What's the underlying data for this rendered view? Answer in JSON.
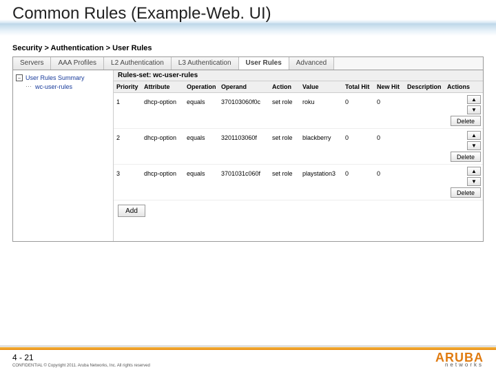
{
  "slide_title": "Common Rules (Example-Web. UI)",
  "breadcrumb": "Security > Authentication > User Rules",
  "tabs": [
    "Servers",
    "AAA Profiles",
    "L2 Authentication",
    "L3 Authentication",
    "User Rules",
    "Advanced"
  ],
  "active_tab": "User Rules",
  "tree": {
    "root": "User Rules Summary",
    "child": "wc-user-rules"
  },
  "grid": {
    "title": "Rules-set: wc-user-rules",
    "headers": [
      "Priority",
      "Attribute",
      "Operation",
      "Operand",
      "Action",
      "Value",
      "Total Hit",
      "New Hit",
      "Description",
      "Actions"
    ],
    "rows": [
      {
        "priority": "1",
        "attribute": "dhcp-option",
        "operation": "equals",
        "operand": "370103060f0c",
        "action": "set role",
        "value": "roku",
        "total_hit": "0",
        "new_hit": "0",
        "description": ""
      },
      {
        "priority": "2",
        "attribute": "dhcp-option",
        "operation": "equals",
        "operand": "3201103060f",
        "action": "set role",
        "value": "blackberry",
        "total_hit": "0",
        "new_hit": "0",
        "description": ""
      },
      {
        "priority": "3",
        "attribute": "dhcp-option",
        "operation": "equals",
        "operand": "3701031c060f",
        "action": "set role",
        "value": "playstation3",
        "total_hit": "0",
        "new_hit": "0",
        "description": ""
      }
    ],
    "buttons": {
      "up": "▲",
      "down": "▼",
      "delete": "Delete",
      "add": "Add"
    }
  },
  "footer": {
    "page": "4 - 21",
    "confidential": "CONFIDENTIAL © Copyright 2011. Aruba Networks, Inc. All rights reserved",
    "logo_top": "ARUBA",
    "logo_bottom": "networks"
  }
}
